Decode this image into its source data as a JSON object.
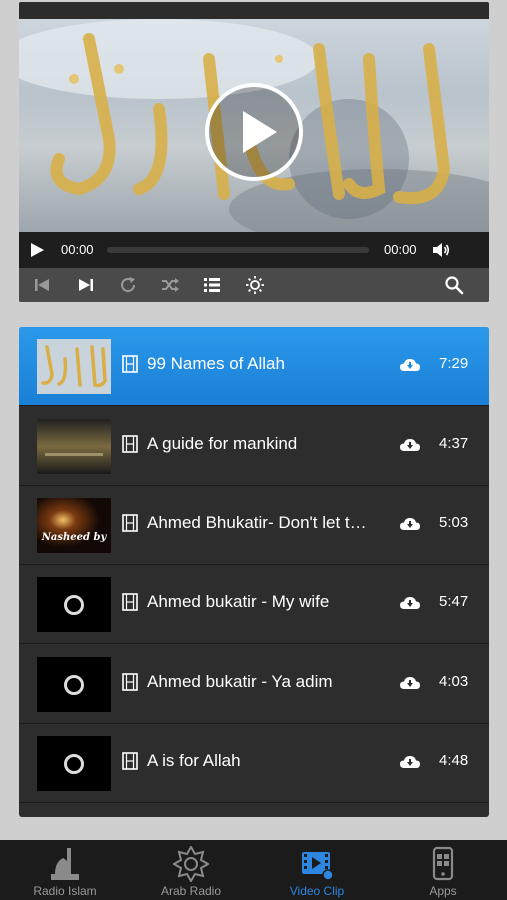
{
  "player": {
    "current_time": "00:00",
    "duration": "00:00",
    "progress": 0
  },
  "toolbar": {
    "icons": [
      "skip-back-icon",
      "skip-forward-icon",
      "repeat-icon",
      "shuffle-icon",
      "playlist-icon",
      "brightness-icon",
      "search-icon"
    ]
  },
  "playlist": {
    "items": [
      {
        "title": "99 Names of Allah",
        "duration": "7:29",
        "thumb": "calligraphy",
        "selected": true
      },
      {
        "title": "A guide for mankind",
        "duration": "4:37",
        "thumb": "guide",
        "selected": false
      },
      {
        "title": "Ahmed Bhukatir- Don't let the world deceive you",
        "duration": "5:03",
        "thumb": "nasheed",
        "selected": false
      },
      {
        "title": "Ahmed bukatir - My wife",
        "duration": "5:47",
        "thumb": "loading",
        "selected": false
      },
      {
        "title": "Ahmed bukatir - Ya adim",
        "duration": "4:03",
        "thumb": "loading",
        "selected": false
      },
      {
        "title": "A is for Allah",
        "duration": "4:48",
        "thumb": "loading",
        "selected": false
      }
    ]
  },
  "thumb_text": {
    "nasheed": "Nasheed by"
  },
  "tabs": [
    {
      "label": "Radio Islam",
      "icon": "mosque-icon",
      "selected": false
    },
    {
      "label": "Arab Radio",
      "icon": "star-ornament-icon",
      "selected": false
    },
    {
      "label": "Video Clip",
      "icon": "video-clip-icon",
      "selected": true
    },
    {
      "label": "Apps",
      "icon": "apps-phone-icon",
      "selected": false
    }
  ],
  "colors": {
    "accent": "#2e86e0",
    "selected_row": "#1f8be0",
    "list_bg": "#2d2d2d",
    "tabbar_bg": "#1b1b1b"
  }
}
